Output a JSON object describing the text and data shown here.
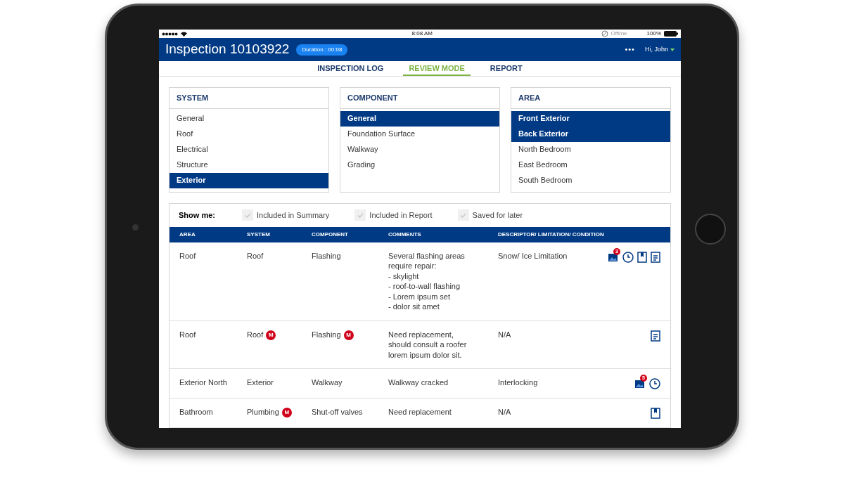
{
  "status_bar": {
    "time": "8:08 AM",
    "network": "Offline",
    "battery": "100%"
  },
  "header": {
    "title": "Inspection 10103922",
    "duration": "Duration : 00:08",
    "more": "•••",
    "user": "Hi, John"
  },
  "tabs": [
    {
      "label": "INSPECTION LOG",
      "selected": false
    },
    {
      "label": "REVIEW MODE",
      "selected": true
    },
    {
      "label": "REPORT",
      "selected": false
    }
  ],
  "filters": [
    {
      "title": "SYSTEM",
      "items": [
        {
          "label": "General",
          "selected": false
        },
        {
          "label": "Roof",
          "selected": false
        },
        {
          "label": "Electrical",
          "selected": false
        },
        {
          "label": "Structure",
          "selected": false
        },
        {
          "label": "Exterior",
          "selected": true
        }
      ]
    },
    {
      "title": "COMPONENT",
      "items": [
        {
          "label": "General",
          "selected": true
        },
        {
          "label": "Foundation Surface",
          "selected": false
        },
        {
          "label": "Walkway",
          "selected": false
        },
        {
          "label": "Grading",
          "selected": false
        }
      ]
    },
    {
      "title": "AREA",
      "items": [
        {
          "label": "Front Exterior",
          "selected": true
        },
        {
          "label": "Back Exterior",
          "selected": true
        },
        {
          "label": "North Bedroom",
          "selected": false
        },
        {
          "label": "East Bedroom",
          "selected": false
        },
        {
          "label": "South Bedroom",
          "selected": false
        }
      ]
    }
  ],
  "show_me": {
    "label": "Show me:",
    "options": [
      {
        "label": "Included in Summary",
        "checked": true
      },
      {
        "label": "Included in Report",
        "checked": true
      },
      {
        "label": "Saved for later",
        "checked": true
      }
    ]
  },
  "table": {
    "columns": [
      "AREA",
      "SYSTEM",
      "COMPONENT",
      "COMMENTS",
      "DESCRIPTOR/ LIMITATION/ CONDITION"
    ],
    "rows": [
      {
        "area": "Roof",
        "system": "Roof",
        "component": "Flashing",
        "comments": [
          "Several flashing areas",
          "require repair:",
          "- skylight",
          "- roof-to-wall flashing",
          "- Lorem ipsum set",
          "- dolor sit amet"
        ],
        "descriptor": "Snow/ Ice Limitation",
        "actions": [
          {
            "kind": "photos",
            "badge": "3"
          },
          {
            "kind": "clock"
          },
          {
            "kind": "bookmark"
          },
          {
            "kind": "note"
          }
        ]
      },
      {
        "area": "Roof",
        "system": "Roof",
        "system_badge": "M",
        "component": "Flashing",
        "component_badge": "M",
        "comments": [
          "Need replacement,",
          "should consult a roofer",
          "lorem ipsum dolor sit."
        ],
        "descriptor": "N/A",
        "actions": [
          {
            "kind": "note"
          }
        ]
      },
      {
        "area": "Exterior North",
        "system": "Exterior",
        "component": "Walkway",
        "comments": [
          "Walkway cracked"
        ],
        "descriptor": "Interlocking",
        "actions": [
          {
            "kind": "photos",
            "badge": "5"
          },
          {
            "kind": "clock"
          }
        ]
      },
      {
        "area": "Bathroom",
        "system": "Plumbing",
        "system_badge": "M",
        "component": "Shut-off valves",
        "comments": [
          "Need replacement"
        ],
        "descriptor": "N/A",
        "actions": [
          {
            "kind": "bookmark"
          }
        ]
      }
    ]
  }
}
